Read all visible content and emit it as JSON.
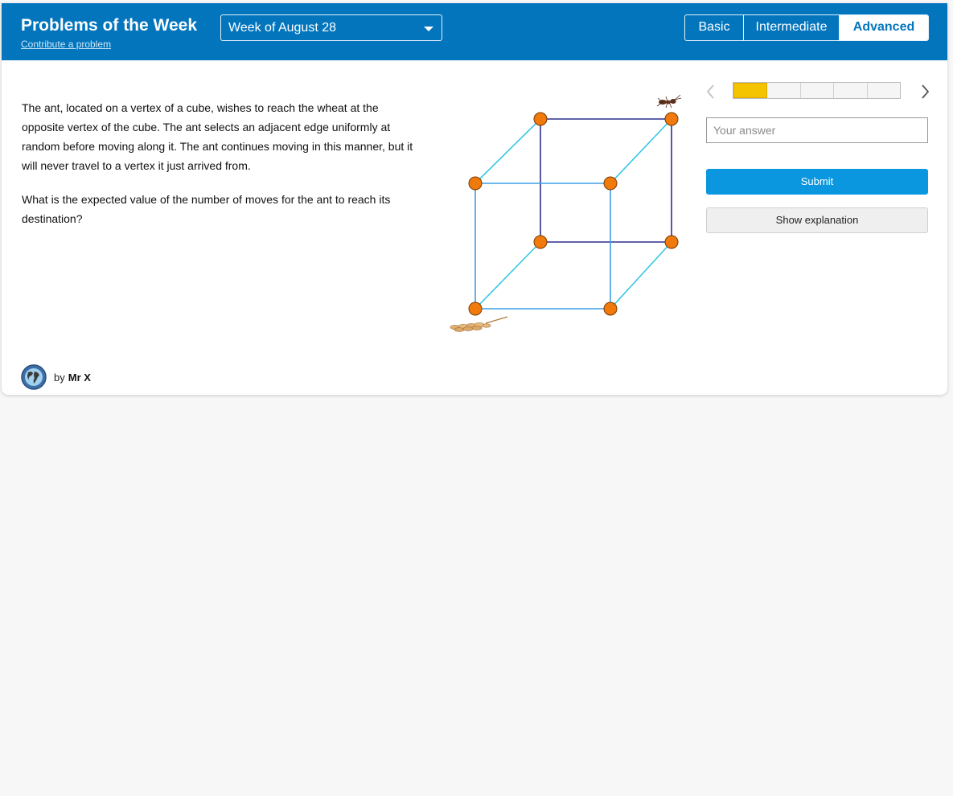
{
  "header": {
    "title": "Problems of the Week",
    "contribute_link": "Contribute a problem",
    "week_select": {
      "value": "Week of August 28"
    },
    "levels": [
      {
        "label": "Basic",
        "active": false
      },
      {
        "label": "Intermediate",
        "active": false
      },
      {
        "label": "Advanced",
        "active": true
      }
    ],
    "accent_color": "#0275bd"
  },
  "problem": {
    "paragraphs": [
      "The ant, located on a vertex of a cube, wishes to reach the wheat at the opposite vertex of the cube. The ant selects an adjacent edge uniformly at random before moving along it. The ant continues moving in this manner, but it will never travel to a vertex it just arrived from.",
      "What is the expected value of the number of moves for the ant to reach its destination?"
    ],
    "figure": {
      "shape": "cube",
      "vertex_color": "#f07a0c",
      "icons": [
        "ant-icon",
        "wheat-icon"
      ]
    },
    "author": {
      "by": "by",
      "name": "Mr X",
      "avatar_icon": "globe-icon"
    }
  },
  "sidebar": {
    "progress": {
      "segments": 5,
      "completed": 1,
      "color": "#f5c400"
    },
    "answer_placeholder": "Your answer",
    "submit_label": "Submit",
    "explanation_label": "Show explanation",
    "submit_color": "#0b97e0"
  }
}
